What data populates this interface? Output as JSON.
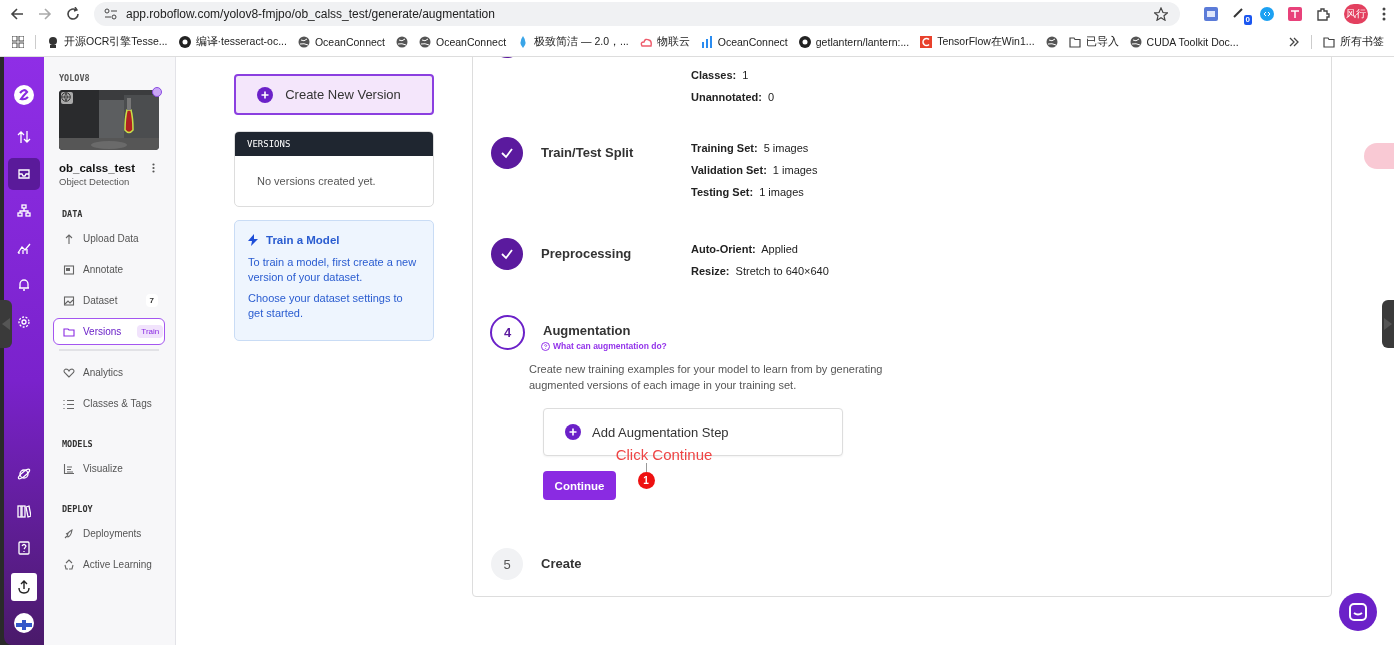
{
  "browser": {
    "url": "app.roboflow.com/yolov8-fmjpo/ob_calss_test/generate/augmentation",
    "extension_badge": "0",
    "profile": "风行",
    "bookmarks": [
      {
        "kind": "link",
        "label": "开源OCR引擎Tesse..."
      },
      {
        "kind": "link",
        "label": "编译·tesseract-oc..."
      },
      {
        "kind": "link",
        "label": "OceanConnect"
      },
      {
        "kind": "icon"
      },
      {
        "kind": "link",
        "label": "OceanConnect"
      },
      {
        "kind": "link",
        "label": "极致简洁 — 2.0，..."
      },
      {
        "kind": "link",
        "label": "物联云"
      },
      {
        "kind": "link",
        "label": "OceanConnect"
      },
      {
        "kind": "link",
        "label": "getlantern/lantern:..."
      },
      {
        "kind": "link",
        "label": "TensorFlow在Win1..."
      },
      {
        "kind": "icon"
      },
      {
        "kind": "link",
        "label": "已导入"
      },
      {
        "kind": "link",
        "label": "CUDA Toolkit Doc..."
      }
    ],
    "all_bookmarks": "所有书签"
  },
  "rail": [
    {
      "selected": false
    },
    {
      "selected": true
    },
    {
      "selected": false
    },
    {
      "selected": false
    },
    {
      "selected": false
    },
    {
      "selected": false
    }
  ],
  "sidebar": {
    "workspace": "YOLOV8",
    "project": "ob_calss_test",
    "project_type": "Object Detection",
    "sections": [
      {
        "title": "DATA",
        "items": [
          {
            "label": "Upload Data",
            "selected": false
          },
          {
            "label": "Annotate",
            "selected": false
          },
          {
            "label": "Dataset",
            "badge": "7",
            "selected": false
          },
          {
            "label": "Versions",
            "badge": "Train",
            "selected": true
          },
          {
            "label": "Analytics",
            "selected": false,
            "divider_before": true
          },
          {
            "label": "Classes & Tags",
            "selected": false
          }
        ]
      },
      {
        "title": "MODELS",
        "items": [
          {
            "label": "Visualize",
            "selected": false
          }
        ]
      },
      {
        "title": "DEPLOY",
        "items": [
          {
            "label": "Deployments",
            "selected": false
          },
          {
            "label": "Active Learning",
            "selected": false
          }
        ]
      }
    ]
  },
  "create_button": "Create New Version",
  "versions_panel": {
    "title": "VERSIONS",
    "empty": "No versions created yet."
  },
  "train_info": {
    "title": "Train a Model",
    "paragraphs": [
      "To train a model, first create a new version of your dataset.",
      "Choose your dataset settings to get started."
    ]
  },
  "steps": [
    {
      "kind": "done",
      "details": [
        {
          "label": "Classes:",
          "value": "1"
        },
        {
          "label": "Unannotated:",
          "value": "0"
        }
      ]
    },
    {
      "kind": "done",
      "title": "Train/Test Split",
      "details": [
        {
          "label": "Training Set:",
          "value": "5 images"
        },
        {
          "label": "Validation Set:",
          "value": "1 images"
        },
        {
          "label": "Testing Set:",
          "value": "1 images"
        }
      ]
    },
    {
      "kind": "done",
      "title": "Preprocessing",
      "details": [
        {
          "label": "Auto-Orient:",
          "value": "Applied"
        },
        {
          "label": "Resize:",
          "value": "Stretch to 640×640"
        }
      ]
    },
    {
      "kind": "active",
      "number": "4",
      "title": "Augmentation",
      "help_link": "What can augmentation do?",
      "description": "Create new training examples for your model to learn from by generating augmented versions of each image in your training set.",
      "add_step": "Add Augmentation Step",
      "continue": "Continue"
    },
    {
      "kind": "pending",
      "number": "5",
      "title": "Create"
    }
  ],
  "annotation": {
    "text": "Click Continue",
    "number": "1"
  }
}
